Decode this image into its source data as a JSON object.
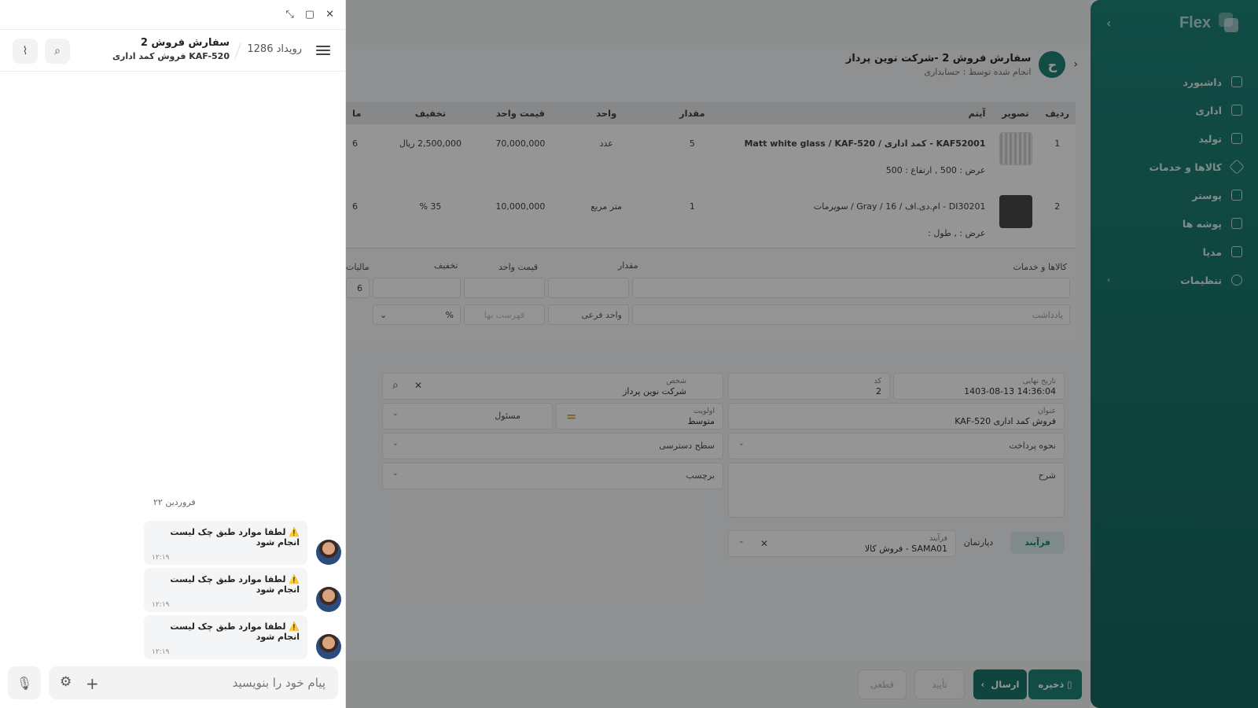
{
  "sidebar": {
    "logo": "Flex",
    "items": [
      {
        "label": "داشبورد",
        "icon": "home-icon"
      },
      {
        "label": "اداری",
        "icon": "office-icon"
      },
      {
        "label": "تولید",
        "icon": "production-icon"
      },
      {
        "label": "کالاها و خدمات",
        "icon": "products-icon"
      },
      {
        "label": "پوستر",
        "icon": "poster-icon"
      },
      {
        "label": "پوشه ها",
        "icon": "folder-icon"
      },
      {
        "label": "مدیا",
        "icon": "media-icon"
      },
      {
        "label": "تنظیمات",
        "icon": "settings-icon"
      }
    ]
  },
  "document": {
    "title": "سفارش فروش 2 -شرکت نوین پرداز",
    "subtitle": "انجام شده توسط : حسابداری",
    "avatar_letter": "ح"
  },
  "items_table": {
    "headers": [
      "ردیف",
      "تصویر",
      "آیتم",
      "مقدار",
      "واحد",
      "قیمت واحد",
      "تخفیف",
      "ما"
    ],
    "rows": [
      {
        "row": "1",
        "item": "KAF52001  -  کمد اداری / Matt white glass / KAF-520",
        "detail": "عرض : 500 ,  ارتفاع : 500",
        "qty": "5",
        "unit": "عدد",
        "unit_price": "70,000,000",
        "discount": "2,500,000 ریال",
        "tax": "6"
      },
      {
        "row": "2",
        "item": "DI30201  -  ام.دی.اف / 16 / Gray / سوپرمات",
        "detail": "عرض : ,  طول :",
        "qty": "1",
        "unit": "متر مربع",
        "unit_price": "10,000,000",
        "discount": "35 %",
        "tax": "6"
      }
    ]
  },
  "add_item": {
    "products_label": "کالاها و خدمات",
    "qty_label": "مقدار",
    "unit_price_label": "قیمت واحد",
    "discount_label": "تخفیف",
    "tax_label": "مالیات",
    "tax_value": "6",
    "note_placeholder": "یادداشت",
    "sub_unit_placeholder": "واحد فرعی",
    "price_list_placeholder": "فهرست بها",
    "percent": "%"
  },
  "form": {
    "deadline_label": "تاریخ نهایی",
    "deadline_value": "1403-08-13 14:36:04",
    "code_label": "کد",
    "code_value": "2",
    "person_label": "شخص",
    "person_value": "شرکت نوین پرداز",
    "title_label": "عنوان",
    "title_value": "فروش کمد اداری  KAF-520",
    "priority_label": "اولویت",
    "priority_value": "متوسط",
    "responsible_label": "مسئول",
    "payment_label": "نحوه پرداخت",
    "access_label": "سطح دسترسی",
    "description_label": "شرح",
    "tag_label": "برچسب",
    "tab_process": "فرآیند",
    "tab_department": "دپارتمان",
    "process_label": "فرآیند",
    "process_value": "SAMA01 - فروش کالا"
  },
  "actions": {
    "save": "ذخیره",
    "send": "ارسال",
    "confirm": "تأیید",
    "final": "قطعی"
  },
  "chat": {
    "title": "سفارش فروش 2",
    "subtitle": "فروش کمد اداری KAF-520",
    "event_count": "رویداد 1286",
    "date": "۲۲ فروردین",
    "messages": [
      {
        "text": "⚠️ لطفا موارد طبق چک لیست انجام شود",
        "time": "۱۲:۱۹"
      },
      {
        "text": "⚠️ لطفا موارد طبق چک لیست انجام شود",
        "time": "۱۲:۱۹"
      },
      {
        "text": "⚠️ لطفا موارد طبق چک لیست انجام شود",
        "time": "۱۲:۱۹"
      }
    ],
    "input_placeholder": "پیام خود را بنویسید"
  }
}
